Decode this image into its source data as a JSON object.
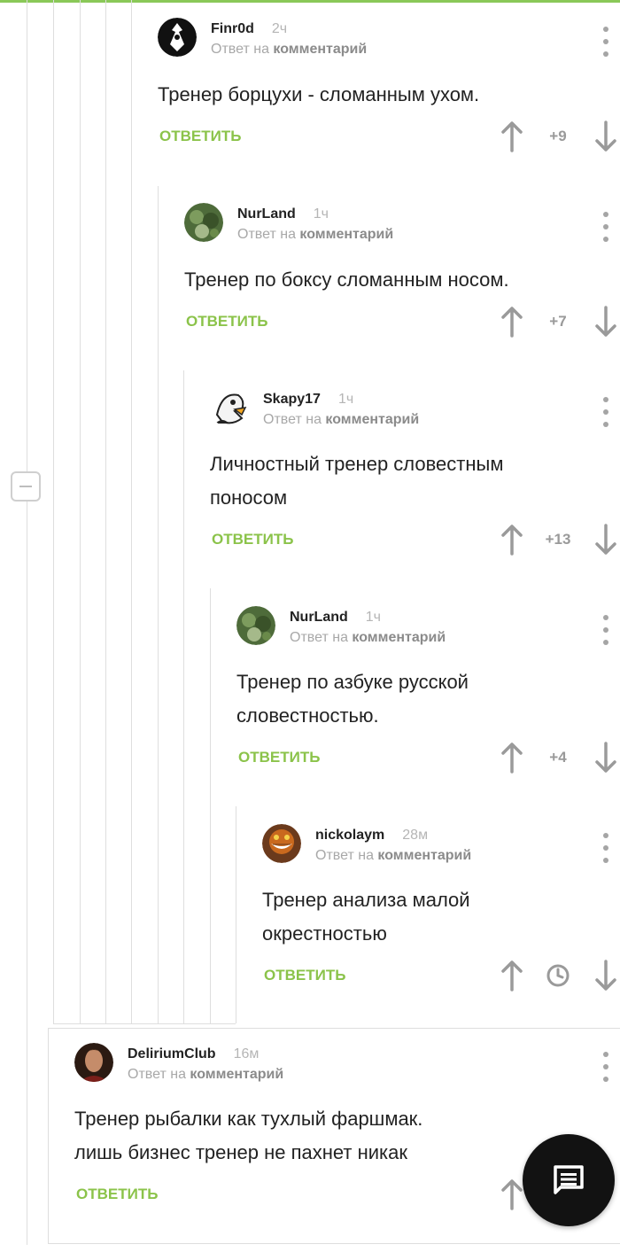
{
  "colors": {
    "accent": "#8bc34a",
    "thread": "#dedede"
  },
  "comments": [
    {
      "id": "finr0d",
      "author": "Finr0d",
      "time": "2ч",
      "reply_prefix": "Ответ на",
      "reply_target": "комментарий",
      "text": "Тренер борцухи - сломанным ухом.",
      "reply_label": "ОТВЕТИТЬ",
      "score": "+9",
      "avatar_icon": "hand-avatar-icon"
    },
    {
      "id": "nurland-1",
      "author": "NurLand",
      "time": "1ч",
      "reply_prefix": "Ответ на",
      "reply_target": "комментарий",
      "text": "Тренер по боксу сломанным носом.",
      "reply_label": "ОТВЕТИТЬ",
      "score": "+7",
      "avatar_icon": "plant-avatar-icon"
    },
    {
      "id": "skapy17",
      "author": "Skapy17",
      "time": "1ч",
      "reply_prefix": "Ответ на",
      "reply_target": "комментарий",
      "text": "Личностный тренер словестным\nпоносом",
      "reply_label": "ОТВЕТИТЬ",
      "score": "+13",
      "avatar_icon": "cartoon-duck-avatar-icon"
    },
    {
      "id": "nurland-2",
      "author": "NurLand",
      "time": "1ч",
      "reply_prefix": "Ответ на",
      "reply_target": "комментарий",
      "text": "Тренер по азбуке русской\nсловестностью.",
      "reply_label": "ОТВЕТИТЬ",
      "score": "+4",
      "avatar_icon": "plant-avatar-icon"
    },
    {
      "id": "nickolaym",
      "author": "nickolaym",
      "time": "28м",
      "reply_prefix": "Ответ на",
      "reply_target": "комментарий",
      "text": "Тренер анализа малой\nокрестностью",
      "reply_label": "ОТВЕТИТЬ",
      "score": "",
      "avatar_icon": "grinning-cat-avatar-icon"
    },
    {
      "id": "deliriumclub",
      "author": "DeliriumClub",
      "time": "16м",
      "reply_prefix": "Ответ на",
      "reply_target": "комментарий",
      "text": "Тренер рыбалки как тухлый фаршмак.\nлишь бизнес тренер не пахнет никак",
      "reply_label": "ОТВЕТИТЬ",
      "score": "",
      "avatar_icon": "portrait-avatar-icon"
    }
  ]
}
